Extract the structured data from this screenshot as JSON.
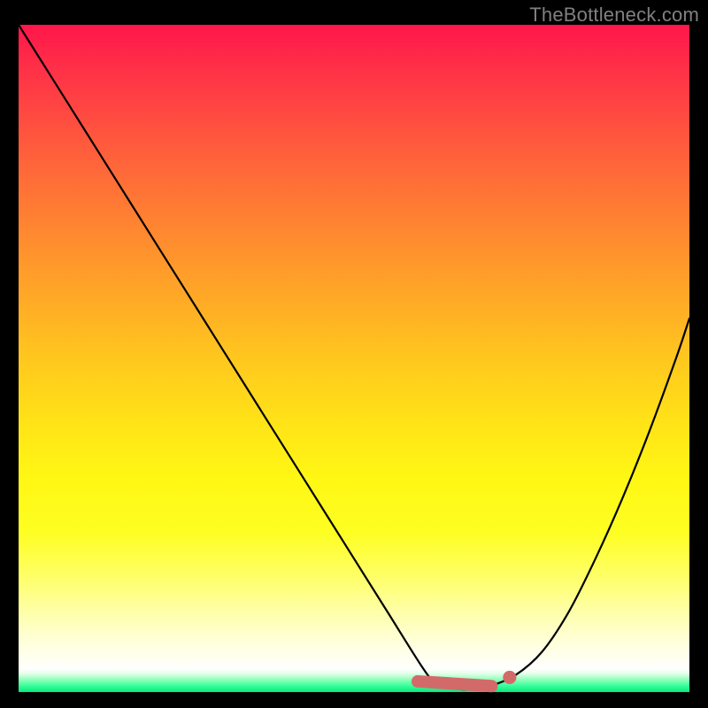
{
  "watermark": "TheBottleneck.com",
  "chart_data": {
    "type": "line",
    "title": "",
    "xlabel": "",
    "ylabel": "",
    "xlim": [
      0,
      100
    ],
    "ylim": [
      0,
      100
    ],
    "grid": false,
    "series": [
      {
        "name": "bottleneck_curve",
        "x": [
          0,
          5,
          10,
          15,
          20,
          25,
          30,
          35,
          40,
          45,
          50,
          55,
          60,
          62,
          64,
          66,
          68,
          70,
          74,
          78,
          82,
          86,
          90,
          94,
          98,
          100
        ],
        "values": [
          100,
          92,
          84,
          76,
          68,
          60,
          52,
          44,
          36,
          28,
          20,
          12,
          4,
          1.5,
          0.8,
          0.4,
          0.4,
          0.8,
          2.5,
          6,
          12,
          20,
          29,
          39,
          50,
          56
        ]
      }
    ],
    "markers": [
      {
        "kind": "segment",
        "x0": 59.5,
        "y0": 1.6,
        "x1": 70.5,
        "y1": 0.9
      },
      {
        "kind": "dot",
        "x": 73.2,
        "y": 2.2,
        "r": 1.0
      }
    ],
    "accent_color": "#d36a6a",
    "curve_color": "#000000"
  }
}
